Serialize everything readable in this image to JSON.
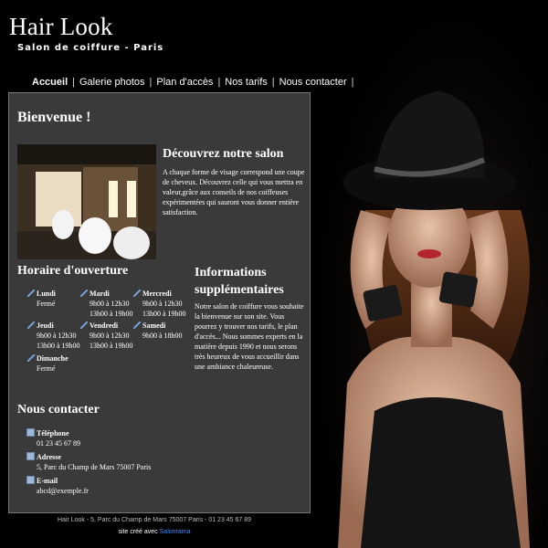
{
  "header": {
    "title": "Hair Look",
    "subtitle": "Salon de coiffure - Paris"
  },
  "nav": {
    "items": [
      "Accueil",
      "Galerie photos",
      "Plan d'accès",
      "Nos tarifs",
      "Nous contacter"
    ],
    "active": "Accueil"
  },
  "welcome": {
    "heading": "Bienvenue !"
  },
  "discover": {
    "heading": "Découvrez notre salon",
    "text": "A chaque forme de visage correspond une coupe de cheveux. Découvrez celle qui vous mettra en valeur,grâce aux conseils de nos coiffeuses expérimentées qui sauront vous donner entière satisfaction."
  },
  "hours": {
    "heading": "Horaire d'ouverture",
    "days": [
      {
        "name": "Lundi",
        "l1": "Fermé",
        "l2": ""
      },
      {
        "name": "Mardi",
        "l1": "9h00 à 12h30",
        "l2": "13h00 à 19h00"
      },
      {
        "name": "Mercredi",
        "l1": "9h00 à 12h30",
        "l2": "13h00 à 19h00"
      },
      {
        "name": "Jeudi",
        "l1": "9h00 à 12h30",
        "l2": "13h00 à 19h00"
      },
      {
        "name": "Vendredi",
        "l1": "9h00 à 12h30",
        "l2": "13h00 à 19h00"
      },
      {
        "name": "Samedi",
        "l1": "9h00 à 18h00",
        "l2": ""
      },
      {
        "name": "Dimanche",
        "l1": "Fermé",
        "l2": ""
      }
    ]
  },
  "info": {
    "heading": "Informations supplémentaires",
    "text": "Notre salon de coiffure vous souhaite la bienvenue sur son site. Vous pourrez y trouver nos tarifs, le plan d'accès... Nous sommes experts en la matière depuis 1990 et nous serons très heureux de vous accueillir dans une ambiance chaleureuse."
  },
  "contact": {
    "heading": "Nous contacter",
    "phone_label": "Téléphone",
    "phone": "01 23 45 67 89",
    "address_label": "Adresse",
    "address": "5, Parc du Champ de Mars 75007 Paris",
    "email_label": "E-mail",
    "email": "abcd@exemple.fr"
  },
  "footer": {
    "line1": "Hair Look - 5, Parc du Champ de Mars 75007 Paris - 01 23 45 67 89",
    "credit_prefix": "site créé avec",
    "credit_link": "Salonrama"
  },
  "colors": {
    "background": "#000000",
    "panel": "#3a3a3a",
    "link": "#3c8cff"
  }
}
